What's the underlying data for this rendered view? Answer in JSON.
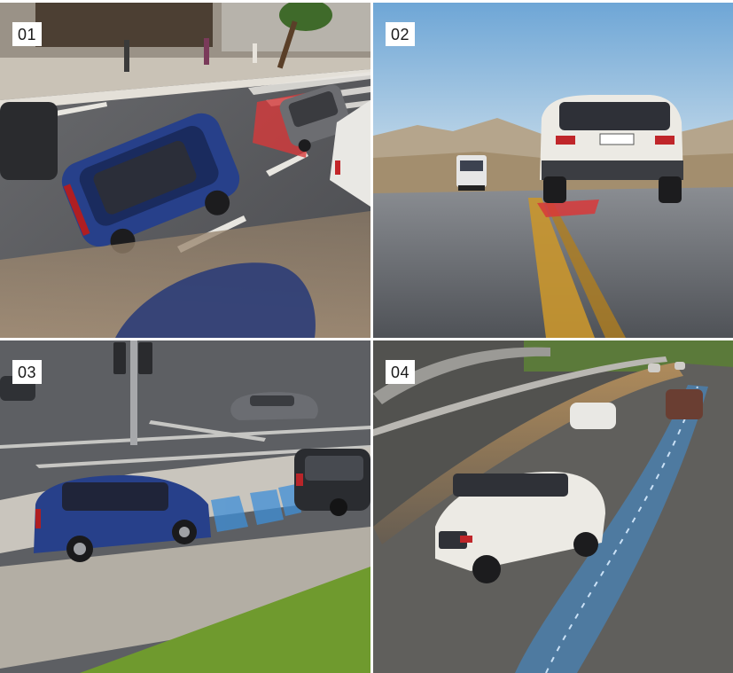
{
  "panels": [
    {
      "label": "01"
    },
    {
      "label": "02"
    },
    {
      "label": "03"
    },
    {
      "label": "04"
    }
  ],
  "colors": {
    "suv_blue": "#27408a",
    "suv_white": "#eceae4",
    "warning_red": "#d8383a",
    "sensor_blue": "#3f8fd8",
    "sky_blue": "#7fb2dc",
    "grass_green": "#6f9a2e",
    "road_gray": "#5d5f63"
  }
}
